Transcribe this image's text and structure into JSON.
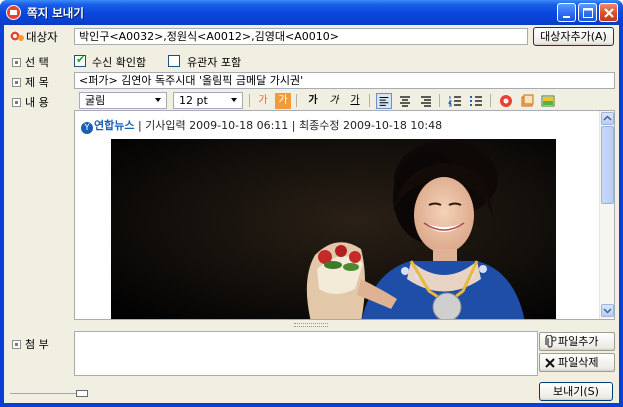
{
  "window": {
    "title": "쪽지 보내기"
  },
  "recipients": {
    "label": "대상자",
    "value": "박인구<A0032>,정원식<A0012>,김영대<A0010>",
    "add_button": "대상자추가(A)"
  },
  "options": {
    "label": "선  택",
    "read_receipt": {
      "label": "수신 확인함",
      "checked": true
    },
    "include_related": {
      "label": "유관자 포함",
      "checked": false
    }
  },
  "subject": {
    "label": "제  목",
    "value": "<퍼가> 김연아 독주시대 '올림픽 금메달 가시권'"
  },
  "content": {
    "label": "내  용"
  },
  "toolbar": {
    "font_family": "굴림",
    "font_size": "12 pt",
    "icons": [
      "text-color-icon",
      "highlight-color-icon",
      "bold-icon",
      "italic-icon",
      "underline-icon",
      "align-left-icon",
      "align-center-icon",
      "align-right-icon",
      "numbered-list-icon",
      "bullet-list-icon",
      "emoticon-icon",
      "insert-table-icon",
      "insert-image-icon"
    ],
    "glyphs": {
      "text_color": "가",
      "highlight": "가",
      "bold": "가",
      "italic": "가",
      "underline": "가"
    }
  },
  "article": {
    "source": "연합뉴스",
    "source_logo": "Y",
    "meta": "| 기사입력 2009-10-18 06:11 | 최종수정 2009-10-18 10:48"
  },
  "attachments": {
    "label": "첨  부",
    "add_button": "파일추가",
    "delete_button": "파일삭제"
  },
  "footer": {
    "send_button": "보내기(S)"
  },
  "colors": {
    "title_bar": "#0a48de",
    "client_bg": "#f1efe2",
    "accent_link": "#1a5fb4"
  }
}
